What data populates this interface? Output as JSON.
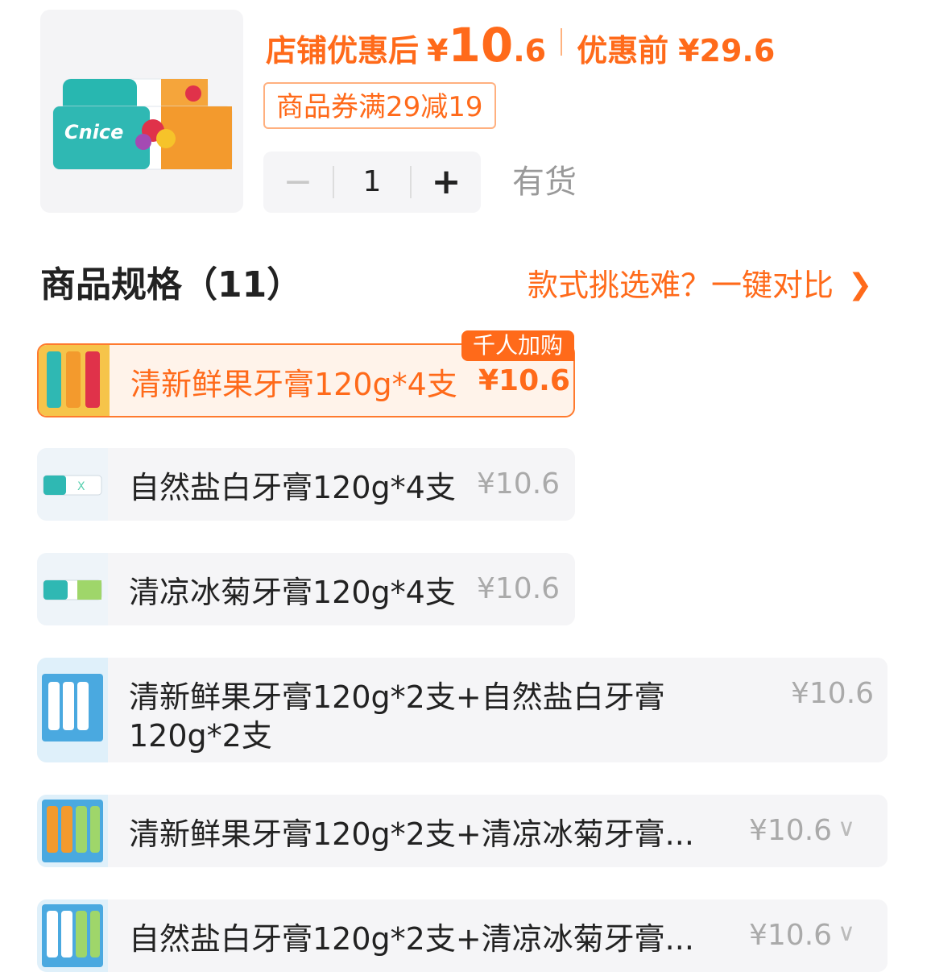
{
  "product": {
    "image_icon": "toothpaste-product-image",
    "brand_text": "Cnice",
    "price_after_label": "店铺优惠后",
    "price_after_symbol": "¥",
    "price_after_int": "10",
    "price_after_dec": ".6",
    "price_before_label": "优惠前",
    "price_before": "¥29.6",
    "coupon": "商品券满29减19",
    "quantity": "1",
    "minus_label": "−",
    "plus_label": "+",
    "stock": "有货"
  },
  "spec": {
    "title": "商品规格（11）",
    "compare_label": "款式挑选难？一键对比",
    "compare_icon": "chevron-right-icon",
    "badge": "千人加购",
    "options": [
      {
        "name": "清新鲜果牙膏120g*4支",
        "price": "¥10.6",
        "selected": true
      },
      {
        "name": "自然盐白牙膏120g*4支",
        "price": "¥10.6"
      },
      {
        "name": "清凉冰菊牙膏120g*4支",
        "price": "¥10.6"
      },
      {
        "name_line1": "清新鲜果牙膏120g*2支+自然盐白牙膏",
        "name_line2": "120g*2支",
        "price": "¥10.6"
      },
      {
        "name": "清新鲜果牙膏120g*2支+清凉冰菊牙膏...",
        "price": "¥10.6",
        "expand_icon": "chevron-down-icon"
      },
      {
        "name": "自然盐白牙膏120g*2支+清凉冰菊牙膏...",
        "price": "¥10.6",
        "expand_icon": "chevron-down-icon"
      }
    ]
  },
  "colors": {
    "accent": "#ff6a1a",
    "muted": "#aaaaaa"
  }
}
